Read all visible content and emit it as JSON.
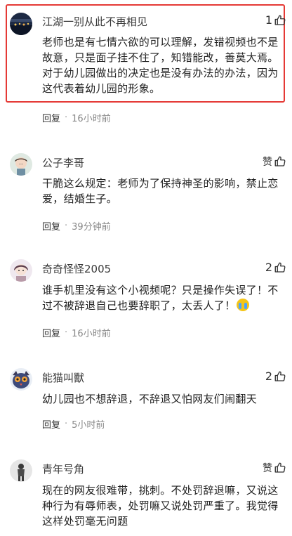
{
  "colors": {
    "highlight": "#e53935",
    "text": "#222222",
    "meta": "#888888"
  },
  "comments": [
    {
      "username": "江湖一别从此不再相见",
      "like_count": "1",
      "like_icon": "thumbs-up-icon",
      "text": "老师也是有七情六欲的可以理解，发错视频也不是故意，只是面子挂不住了，知错能改，善莫大焉。对于幼儿园做出的决定也是没有办法的办法，因为这代表着幼儿园的形象。",
      "reply": "回复",
      "separator": "·",
      "time": "16小时前"
    },
    {
      "username": "公子李哥",
      "like_count": "赞",
      "like_icon": "thumbs-up-icon",
      "text": "干脆这么规定：老师为了保持神圣的影响，禁止恋爱，结婚生子。",
      "reply": "回复",
      "separator": "·",
      "time": "39分钟前"
    },
    {
      "username": "奇奇怪怪2005",
      "like_count": "2",
      "like_icon": "thumbs-up-icon",
      "text": "谁手机里没有这个小视频呢？只是操作失误了！不过不被辞退自己也要辞职了，太丢人了！",
      "emoji": "crying-laughing-emoji",
      "reply": "回复",
      "separator": "·",
      "time": "16小时前"
    },
    {
      "username": "能猫叫獸",
      "like_count": "2",
      "like_icon": "thumbs-up-icon",
      "text": "幼儿园也不想辞退，不辞退又怕网友们闹翻天",
      "reply": "回复",
      "separator": "·",
      "time": "5小时前"
    },
    {
      "username": "青年号角",
      "like_count": "赞",
      "like_icon": "thumbs-up-icon",
      "text": "现在的网友很难带，挑刺。不处罚辞退嘛，又说这种行为有辱师表，处罚嘛又说处罚严重了。我觉得这样处罚毫无问题"
    }
  ]
}
